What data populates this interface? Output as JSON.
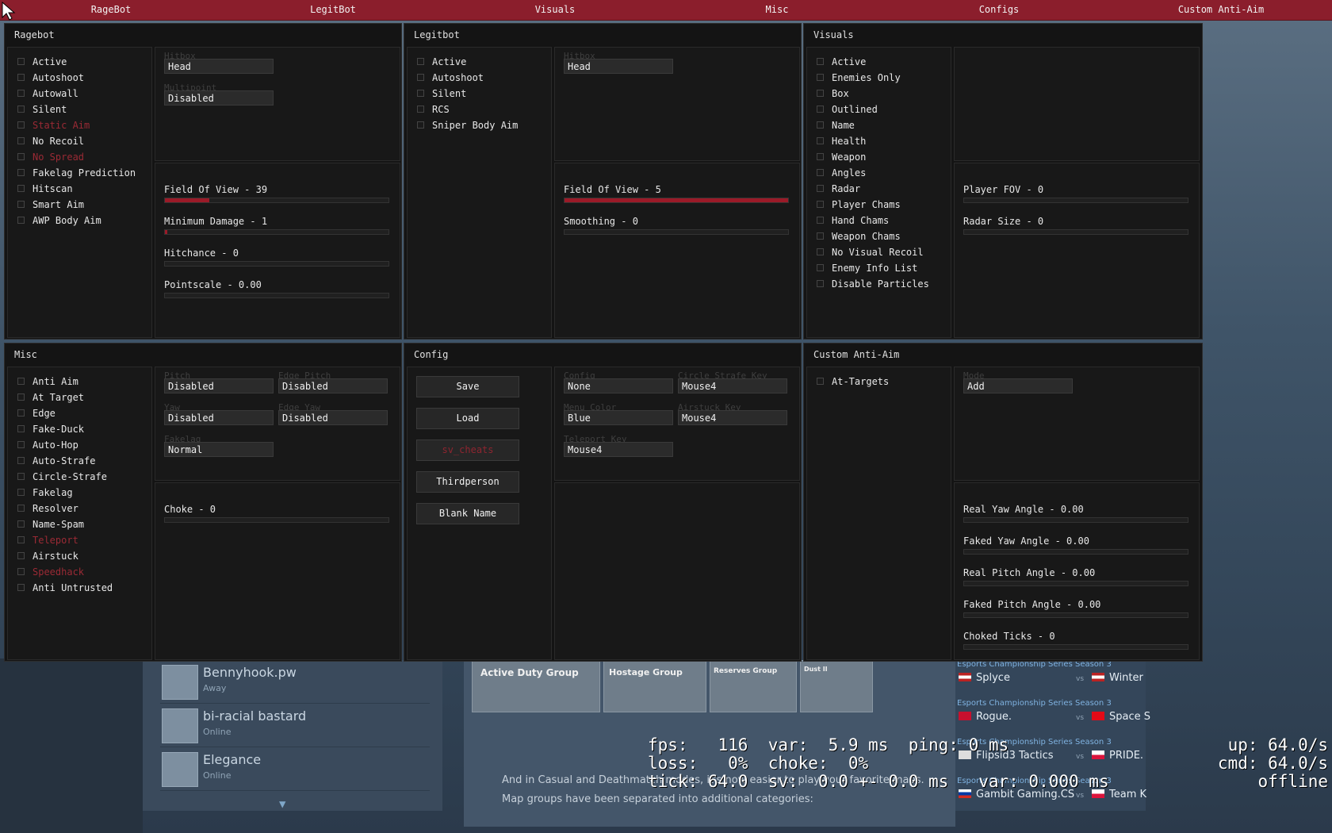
{
  "topbar": {
    "tabs": [
      "RageBot",
      "LegitBot",
      "Visuals",
      "Misc",
      "Configs",
      "Custom Anti-Aim"
    ]
  },
  "rage": {
    "title": "Ragebot",
    "checks": [
      {
        "label": "Active"
      },
      {
        "label": "Autoshoot"
      },
      {
        "label": "Autowall"
      },
      {
        "label": "Silent"
      },
      {
        "label": "Static Aim",
        "disabled": true
      },
      {
        "label": "No Recoil"
      },
      {
        "label": "No Spread",
        "disabled": true
      },
      {
        "label": "Fakelag Prediction"
      },
      {
        "label": "Hitscan"
      },
      {
        "label": "Smart Aim"
      },
      {
        "label": "AWP Body Aim"
      }
    ],
    "hitbox_cap": "Hitbox",
    "hitbox_val": "Head",
    "multipoint_cap": "Multipoint",
    "multipoint_val": "Disabled",
    "sliders": [
      {
        "label": "Field Of View - 39",
        "fill": 0.2
      },
      {
        "label": "Minimum Damage - 1",
        "fill": 0.01
      },
      {
        "label": "Hitchance - 0",
        "fill": 0
      },
      {
        "label": "Pointscale - 0.00",
        "fill": 0
      }
    ]
  },
  "legit": {
    "title": "Legitbot",
    "checks": [
      {
        "label": "Active"
      },
      {
        "label": "Autoshoot"
      },
      {
        "label": "Silent"
      },
      {
        "label": "RCS"
      },
      {
        "label": "Sniper Body Aim"
      }
    ],
    "hitbox_cap": "Hitbox",
    "hitbox_val": "Head",
    "sliders": [
      {
        "label": "Field Of View - 5",
        "fill": 1
      },
      {
        "label": "Smoothing - 0",
        "fill": 0
      }
    ]
  },
  "visuals": {
    "title": "Visuals",
    "checks": [
      {
        "label": "Active"
      },
      {
        "label": "Enemies Only"
      },
      {
        "label": "Box"
      },
      {
        "label": "Outlined"
      },
      {
        "label": "Name"
      },
      {
        "label": "Health"
      },
      {
        "label": "Weapon"
      },
      {
        "label": "Angles"
      },
      {
        "label": "Radar"
      },
      {
        "label": "Player Chams"
      },
      {
        "label": "Hand Chams"
      },
      {
        "label": "Weapon Chams"
      },
      {
        "label": "No Visual Recoil"
      },
      {
        "label": "Enemy Info List"
      },
      {
        "label": "Disable Particles"
      }
    ],
    "sliders": [
      {
        "label": "Player FOV - 0",
        "fill": 0
      },
      {
        "label": "Radar Size - 0",
        "fill": 0
      }
    ]
  },
  "misc": {
    "title": "Misc",
    "checks": [
      {
        "label": "Anti Aim"
      },
      {
        "label": "At Target"
      },
      {
        "label": "Edge"
      },
      {
        "label": "Fake-Duck"
      },
      {
        "label": "Auto-Hop"
      },
      {
        "label": "Auto-Strafe"
      },
      {
        "label": "Circle-Strafe"
      },
      {
        "label": "Fakelag"
      },
      {
        "label": "Resolver"
      },
      {
        "label": "Name-Spam"
      },
      {
        "label": "Teleport",
        "disabled": true
      },
      {
        "label": "Airstuck"
      },
      {
        "label": "Speedhack",
        "disabled": true
      },
      {
        "label": "Anti Untrusted"
      }
    ],
    "pitch_cap": "Pitch",
    "pitch_val": "Disabled",
    "edgepitch_cap": "Edge Pitch",
    "edgepitch_val": "Disabled",
    "yaw_cap": "Yaw",
    "yaw_val": "Disabled",
    "edgeyaw_cap": "Edge Yaw",
    "edgeyaw_val": "Disabled",
    "fakelag_cap": "Fakelag",
    "fakelag_val": "Normal",
    "sliders": [
      {
        "label": "Choke - 0",
        "fill": 0
      }
    ]
  },
  "config": {
    "title": "Config",
    "buttons": [
      {
        "label": "Save"
      },
      {
        "label": "Load"
      },
      {
        "label": "sv_cheats",
        "disabled": true
      },
      {
        "label": "Thirdperson"
      },
      {
        "label": "Blank Name"
      }
    ],
    "config_cap": "Config",
    "config_val": "None",
    "circle_cap": "Circle Strafe Key",
    "circle_val": "Mouse4",
    "menucolor_cap": "Menu Color",
    "menucolor_val": "Blue",
    "airstuck_cap": "Airstuck Key",
    "airstuck_val": "Mouse4",
    "teleport_cap": "Teleport Key",
    "teleport_val": "Mouse4"
  },
  "aa": {
    "title": "Custom Anti-Aim",
    "checks": [
      {
        "label": "At-Targets"
      }
    ],
    "mode_cap": "Mode",
    "mode_val": "Add",
    "sliders": [
      {
        "label": "Real Yaw Angle - 0.00",
        "fill": 0
      },
      {
        "label": "Faked Yaw Angle - 0.00",
        "fill": 0
      },
      {
        "label": "Real Pitch Angle - 0.00",
        "fill": 0
      },
      {
        "label": "Faked Pitch Angle - 0.00",
        "fill": 0
      },
      {
        "label": "Choked Ticks - 0",
        "fill": 0
      }
    ]
  },
  "friends": [
    {
      "name": "Bennyhook.pw",
      "status": "Away"
    },
    {
      "name": "bi-racial bastard",
      "status": "Online"
    },
    {
      "name": "Elegance",
      "status": "Online"
    }
  ],
  "news": {
    "groups": [
      "Active Duty Group",
      "Hostage Group",
      "Reserves Group",
      "Dust II"
    ],
    "text": "And in Casual and Deathmatch modes, it's now easier to play your favorite maps. Map groups have been separated into additional categories:"
  },
  "matches": [
    {
      "league": "Esports Championship Series Season 3",
      "team1": "Splyce",
      "team2": "Winter"
    },
    {
      "league": "Esports Championship Series Season 3",
      "team1": "Rogue.",
      "team2": "Space S"
    },
    {
      "league": "Esports Championship Series Season 3",
      "team1": "Flipsid3 Tactics",
      "team2": "PRIDE."
    },
    {
      "league": "Esports Championship Series Season 3",
      "team1": "Gambit Gaming.CS",
      "team2": "Team K"
    }
  ],
  "netgraph": {
    "line1": "fps:   116  var:  5.9 ms  ping: 0 ms",
    "line2": "loss:   0%  choke:  0%",
    "line3": "tick: 64.0  sv:  0.0 +- 0.0 ms   var: 0.000 ms",
    "up": "up: 64.0/s",
    "cmd": "cmd: 64.0/s",
    "status": "offline"
  }
}
